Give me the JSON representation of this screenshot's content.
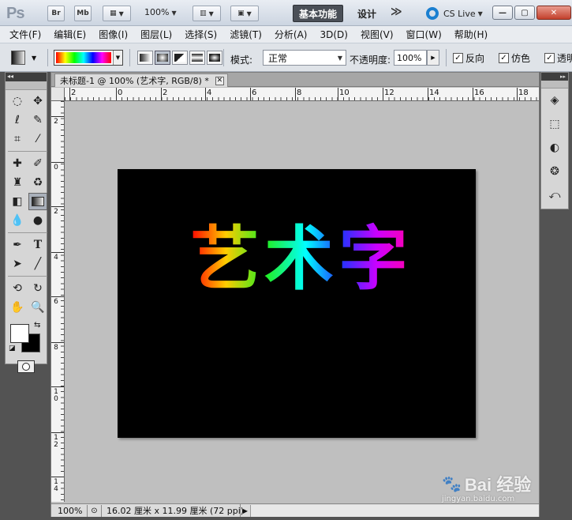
{
  "titlebar": {
    "app_logo": "Ps",
    "bridge_label": "Br",
    "minibridge_label": "Mb",
    "zoom_value": "100%",
    "workspace_active": "基本功能",
    "workspace_design": "设计",
    "more_label": "≫",
    "cs_live_label": "CS Live",
    "minimize_glyph": "—",
    "maximize_glyph": "▢",
    "close_glyph": "✕"
  },
  "menu": [
    "文件(F)",
    "编辑(E)",
    "图像(I)",
    "图层(L)",
    "选择(S)",
    "滤镜(T)",
    "分析(A)",
    "3D(D)",
    "视图(V)",
    "窗口(W)",
    "帮助(H)"
  ],
  "options": {
    "mode_label": "模式:",
    "mode_value": "正常",
    "opacity_label": "不透明度:",
    "opacity_value": "100%",
    "reverse_label": "反向",
    "dither_label": "仿色",
    "transparency_label": "透明"
  },
  "document": {
    "tab_title": "未标题-1 @ 100% (艺术字, RGB/8) *",
    "tab_close": "✕",
    "canvas_text": "艺术字",
    "zoom": "100%",
    "doc_info": "16.02 厘米 x 11.99 厘米 (72 ppi)",
    "ruler_h_labels": [
      "2",
      "0",
      "2",
      "4",
      "6",
      "8",
      "10",
      "12",
      "14",
      "16",
      "18"
    ],
    "ruler_v_labels": [
      "2",
      "0",
      "2",
      "4",
      "6",
      "8",
      "1\n0",
      "1\n2",
      "1\n4"
    ]
  },
  "watermark": {
    "brand": "Bai 经验",
    "url": "jingyan.baidu.com"
  },
  "colors": {
    "accent": "#4a4f57",
    "canvas_bg": "#000000",
    "foreground": "#ffffff",
    "background": "#000000"
  }
}
